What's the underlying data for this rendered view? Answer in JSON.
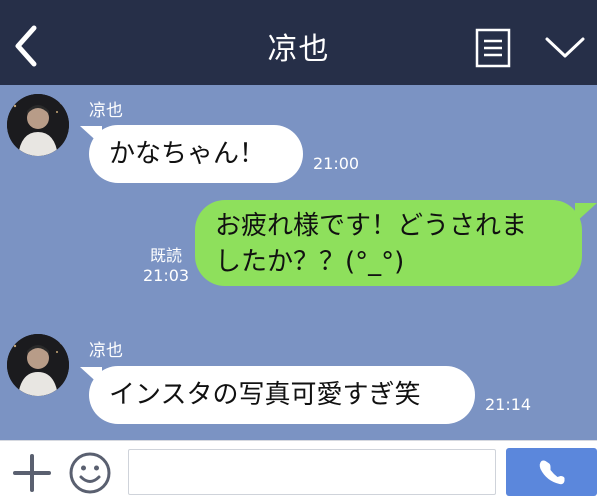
{
  "header": {
    "title": "凉也"
  },
  "messages": [
    {
      "direction": "incoming",
      "sender": "凉也",
      "text": "かなちゃん！",
      "time": "21:00"
    },
    {
      "direction": "outgoing",
      "text_line1": "お疲れ様です！どうされま",
      "text_line2": "したか？？(°_°)",
      "read_label": "既読",
      "time": "21:03"
    },
    {
      "direction": "incoming",
      "sender": "凉也",
      "text": "インスタの写真可愛すぎ笑",
      "time": "21:14"
    }
  ],
  "input": {
    "placeholder": ""
  },
  "icons": {
    "back": "chevron-left-icon",
    "notes": "notes-icon",
    "menu": "chevron-down-icon",
    "add": "plus-icon",
    "emoji": "smiley-icon",
    "call": "phone-icon"
  },
  "colors": {
    "header_bg": "#262f48",
    "chat_bg": "#7b93c3",
    "outgoing_bubble": "#8ee05c",
    "incoming_bubble": "#ffffff",
    "call_button": "#5b87dc"
  }
}
